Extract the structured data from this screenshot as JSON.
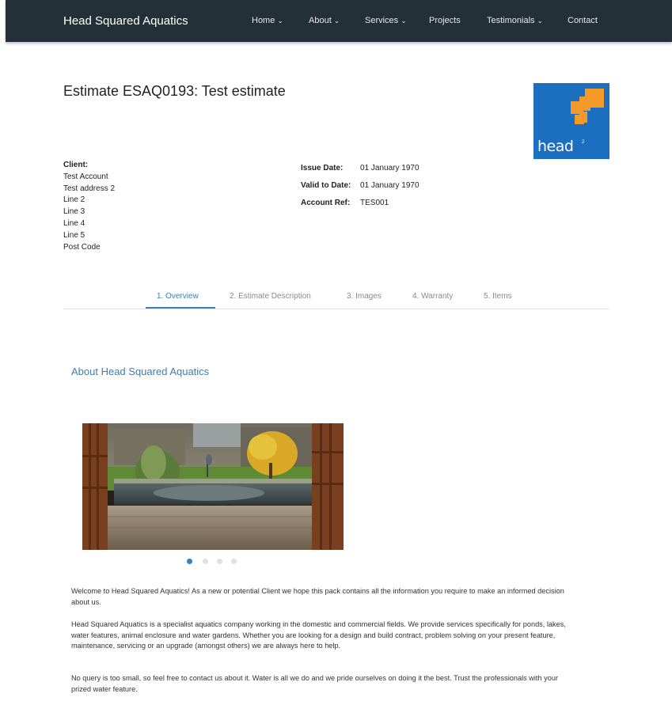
{
  "navbar": {
    "brand": "Head Squared Aquatics",
    "items": [
      {
        "label": "Home",
        "caret": "⌄"
      },
      {
        "label": "About",
        "caret": "⌄"
      },
      {
        "label": "Services",
        "caret": "⌄"
      },
      {
        "label": "Projects",
        "caret": ""
      },
      {
        "label": "Testimonials",
        "caret": "⌄"
      },
      {
        "label": "Contact",
        "caret": ""
      }
    ]
  },
  "estimate": {
    "title": "Estimate ESAQ0193: Test estimate",
    "logo_text": "head",
    "logo_sup": "2"
  },
  "client": {
    "label": "Client:",
    "lines": [
      "Test Account",
      "Test address 2",
      "Line 2",
      "Line 3",
      "Line 4",
      "Line 5",
      "Post Code"
    ]
  },
  "info": [
    {
      "key": "Issue Date:",
      "value": "01 January 1970"
    },
    {
      "key": "Valid to Date:",
      "value": "01 January 1970"
    },
    {
      "key": "Account Ref:",
      "value": "TES001"
    }
  ],
  "tabs": [
    {
      "label": "1. Overview"
    },
    {
      "label": "2. Estimate Description"
    },
    {
      "label": "3. Images"
    },
    {
      "label": "4. Warranty"
    },
    {
      "label": "5. Items"
    }
  ],
  "overview": {
    "heading": "About Head Squared Aquatics",
    "carousel": {
      "slides": 4,
      "active": 1
    },
    "paragraphs": [
      "Welcome to Head Squared Aquatics! As a new or potential Client we hope this pack contains all the information you require to make an informed decision about us.",
      "Head Squared Aquatics is a specialist aquatics company working in the domestic and commercial fields. We provide services specifically for ponds, lakes, water features, animal enclosure and water gardens. Whether you are looking for a design and build contract, problem solving on your present feature, maintenance, servicing or an upgrade (amongst others) we are always here to help.",
      "No query is too small, so feel free to contact us about it. Water is all we do and we pride ourselves on doing it the best. Trust the professionals with your prized water feature."
    ]
  },
  "colors": {
    "navbar": "#243038",
    "accent": "#3c7fb1",
    "logo_bg": "#1c6fc0",
    "logo_squares": "#f39a28"
  }
}
